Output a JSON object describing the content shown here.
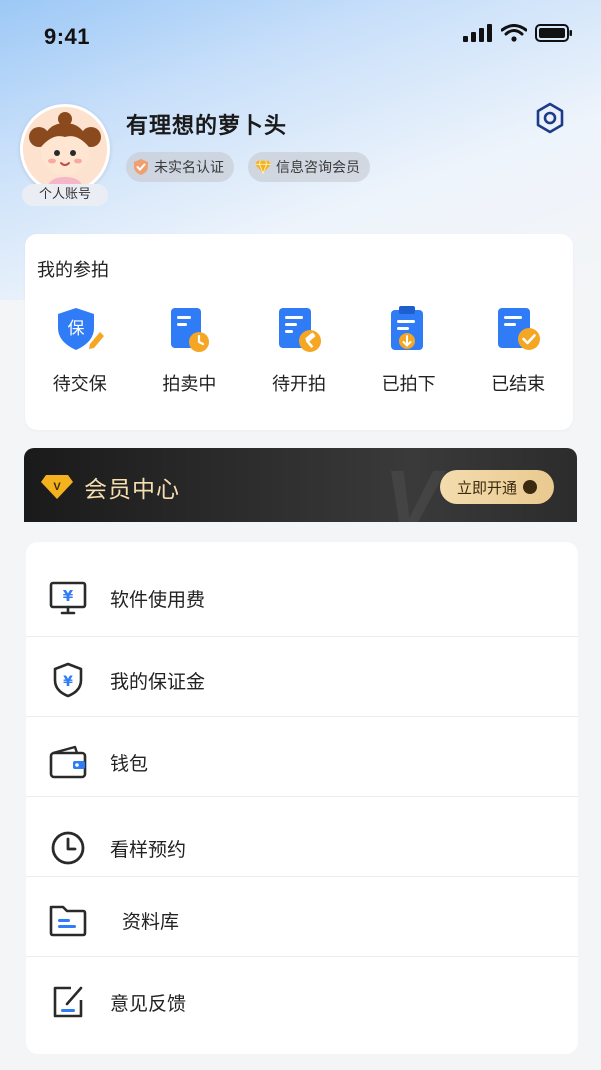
{
  "status_bar": {
    "time": "9:41"
  },
  "profile": {
    "nickname": "有理想的萝卜头",
    "account_tag": "个人账号",
    "badges": [
      {
        "label": "未实名认证",
        "icon": "verify-icon"
      },
      {
        "label": "信息咨询会员",
        "icon": "diamond-icon"
      }
    ]
  },
  "my_bids": {
    "title": "我的参拍",
    "items": [
      {
        "label": "待交保",
        "icon": "shield-deposit-icon",
        "icon_text": "保"
      },
      {
        "label": "拍卖中",
        "icon": "doc-clock-icon"
      },
      {
        "label": "待开拍",
        "icon": "doc-gavel-icon"
      },
      {
        "label": "已拍下",
        "icon": "clipboard-download-icon"
      },
      {
        "label": "已结束",
        "icon": "doc-check-icon"
      }
    ]
  },
  "vip": {
    "title": "会员中心",
    "button": "立即开通",
    "watermark": "V",
    "badge_letter": "V"
  },
  "menu": {
    "items": [
      {
        "label": "软件使用费",
        "icon": "monitor-yen-icon",
        "glyph": "¥"
      },
      {
        "label": "我的保证金",
        "icon": "shield-yen-icon",
        "glyph": "¥"
      },
      {
        "label": "钱包",
        "icon": "wallet-icon"
      },
      {
        "label": "看样预约",
        "icon": "clock-icon"
      },
      {
        "label": "资料库",
        "icon": "folder-icon"
      },
      {
        "label": "意见反馈",
        "icon": "feedback-icon"
      }
    ]
  },
  "colors": {
    "primary_blue": "#2f7cf6",
    "accent_orange": "#f5a623",
    "vip_gold": "#f4dcae"
  }
}
